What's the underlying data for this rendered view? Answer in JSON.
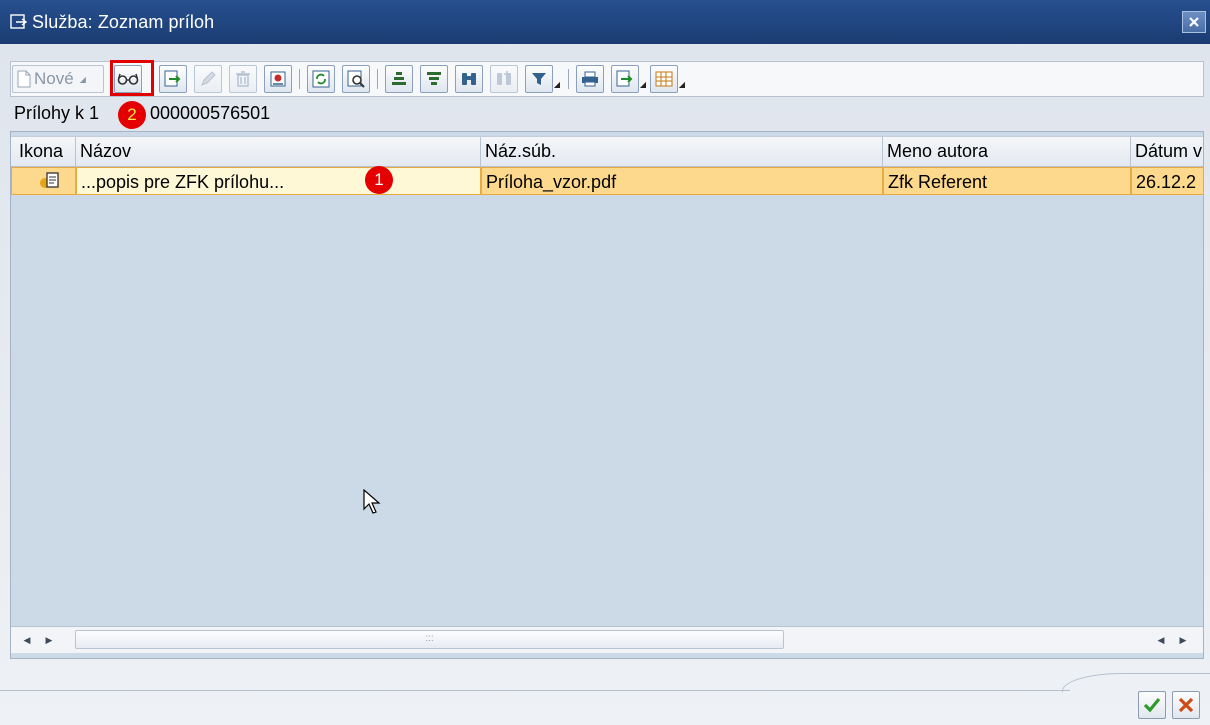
{
  "window": {
    "title": "Služba: Zoznam príloh"
  },
  "toolbar": {
    "new_label": "Nové",
    "buttons": [
      {
        "name": "display-icon",
        "highlighted": true
      },
      {
        "name": "export-icon"
      },
      {
        "name": "edit-pencil-icon",
        "disabled": true
      },
      {
        "name": "delete-icon",
        "disabled": true
      },
      {
        "name": "attributes-icon"
      },
      {
        "name": "refresh-icon"
      },
      {
        "name": "details-icon"
      },
      {
        "name": "sort-ascending-icon"
      },
      {
        "name": "sort-descending-icon"
      },
      {
        "name": "find-icon"
      },
      {
        "name": "find-next-icon",
        "disabled": true
      },
      {
        "name": "filter-icon"
      },
      {
        "name": "print-icon"
      },
      {
        "name": "export-list-icon"
      },
      {
        "name": "layout-icon"
      }
    ]
  },
  "attachments_label": {
    "prefix": "Prílohy k 1",
    "suffix": "000000576501"
  },
  "table": {
    "columns": [
      "Ikona",
      "Názov",
      "Náz.súb.",
      "Meno autora",
      "Dátum v"
    ],
    "rows": [
      {
        "icon": "document-icon",
        "name": "...popis pre ZFK prílohu...",
        "file": "Príloha_vzor.pdf",
        "author": "Zfk Referent",
        "date": "26.12.2"
      }
    ]
  },
  "annotations": {
    "marker_1": "1",
    "marker_2": "2"
  },
  "footer": {
    "buttons": [
      "confirm-check-icon",
      "cancel-x-icon"
    ]
  },
  "colors": {
    "titlebar": "#1f4580",
    "selected_row": "#fcd98c",
    "table_background": "#ccd9e6",
    "highlight_marker": "#e40000"
  }
}
